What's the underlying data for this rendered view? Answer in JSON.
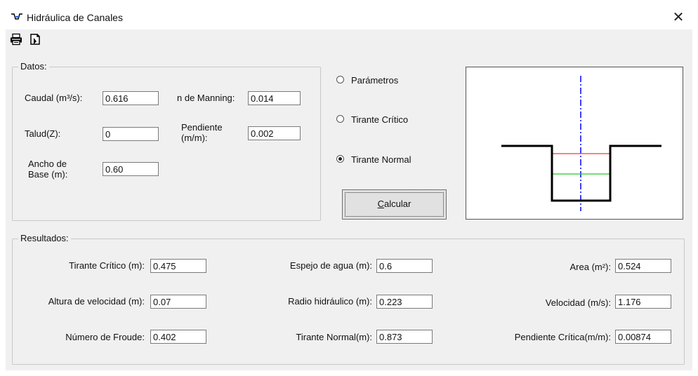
{
  "window": {
    "title": "Hidráulica de Canales",
    "close_symbol": "✕"
  },
  "toolbar": {
    "icons": [
      "printer-icon",
      "print-preview-icon"
    ]
  },
  "datos": {
    "legend": "Datos:",
    "caudal": {
      "label": "Caudal (m³/s):",
      "value": "0.616"
    },
    "talud": {
      "label": "Talud(Z):",
      "value": "0"
    },
    "ancho": {
      "label_1": "Ancho de",
      "label_2": "Base (m):",
      "value": "0.60"
    },
    "manning": {
      "label": "n de Manning:",
      "value": "0.014"
    },
    "pendiente": {
      "label_1": "Pendiente",
      "label_2": "(m/m):",
      "value": "0.002"
    }
  },
  "options": {
    "items": [
      {
        "label": "Parámetros",
        "selected": false
      },
      {
        "label": "Tirante Crítico",
        "selected": false
      },
      {
        "label": "Tirante Normal",
        "selected": true
      }
    ]
  },
  "calcular": {
    "accel": "C",
    "rest": "alcular"
  },
  "diagram": {
    "channel_color": "#000000",
    "critical_depth_color": "#ff3333",
    "normal_depth_color": "#22cc22",
    "axis_color": "#0000ff"
  },
  "resultados": {
    "legend": "Resultados:",
    "tirante_critico": {
      "label": "Tirante Crítico (m):",
      "value": "0.475"
    },
    "altura_velocidad": {
      "label": "Altura de velocidad (m):",
      "value": "0.07"
    },
    "numero_froude": {
      "label": "Número de Froude:",
      "value": "0.402"
    },
    "espejo_agua": {
      "label": "Espejo de agua (m):",
      "value": "0.6"
    },
    "radio_hidraulico": {
      "label": "Radio hidráulico (m):",
      "value": "0.223"
    },
    "tirante_normal": {
      "label": "Tirante Normal(m):",
      "value": "0.873"
    },
    "area": {
      "label": "Area (m²):",
      "value": "0.524"
    },
    "velocidad": {
      "label": "Velocidad (m/s):",
      "value": "1.176"
    },
    "pendiente_critica": {
      "label": "Pendiente Crítica(m/m):",
      "value": "0.00874"
    }
  }
}
